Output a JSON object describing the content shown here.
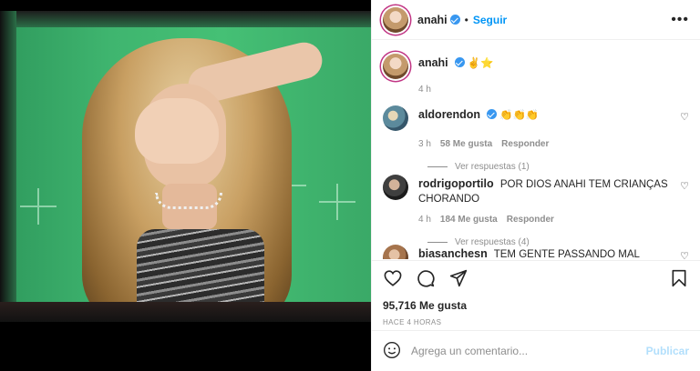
{
  "post": {
    "author": "anahi",
    "follow_label": "Seguir",
    "separator": "•",
    "caption": {
      "username": "anahi",
      "text": "✌️⭐",
      "time": "4 h"
    }
  },
  "comments": [
    {
      "username": "aldorendon",
      "verified": true,
      "text": "👏👏👏",
      "time": "3 h",
      "likes": "58 Me gusta",
      "reply_label": "Responder",
      "replies_label": "Ver respuestas (1)"
    },
    {
      "username": "rodrigoportilo",
      "verified": false,
      "text": "POR DIOS ANAHI TEM CRIANÇAS CHORANDO",
      "time": "4 h",
      "likes": "184 Me gusta",
      "reply_label": "Responder",
      "replies_label": "Ver respuestas (4)"
    },
    {
      "username": "biasanchesn",
      "verified": false,
      "text": "TEM GENTE PASSANDO MAL"
    }
  ],
  "footer": {
    "likes": "95,716 Me gusta",
    "time_ago": "HACE 4 HORAS",
    "comment_placeholder": "Agrega un comentario...",
    "publish_label": "Publicar"
  },
  "icons": {
    "like": "heart-icon",
    "comment": "comment-icon",
    "share": "share-icon",
    "save": "bookmark-icon",
    "emoji": "emoji-icon",
    "more": "more-options-icon"
  },
  "colors": {
    "link_blue": "#0095f6",
    "verified_blue": "#3897f0",
    "muted_text": "#8e8e8e",
    "publish_disabled": "#b2dffc",
    "story_ring": "#c13584"
  }
}
